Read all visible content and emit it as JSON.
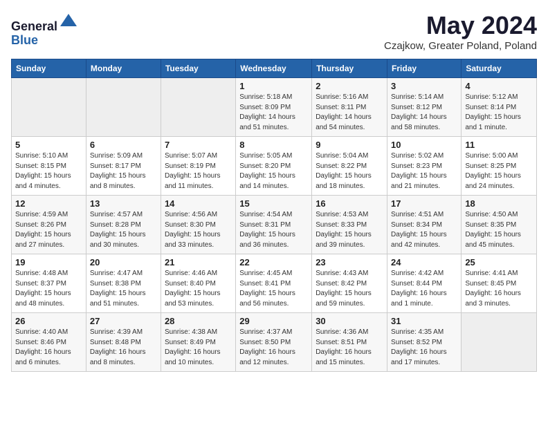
{
  "header": {
    "logo_line1": "General",
    "logo_line2": "Blue",
    "month": "May 2024",
    "location": "Czajkow, Greater Poland, Poland"
  },
  "weekdays": [
    "Sunday",
    "Monday",
    "Tuesday",
    "Wednesday",
    "Thursday",
    "Friday",
    "Saturday"
  ],
  "weeks": [
    [
      {
        "day": "",
        "info": ""
      },
      {
        "day": "",
        "info": ""
      },
      {
        "day": "",
        "info": ""
      },
      {
        "day": "1",
        "info": "Sunrise: 5:18 AM\nSunset: 8:09 PM\nDaylight: 14 hours\nand 51 minutes."
      },
      {
        "day": "2",
        "info": "Sunrise: 5:16 AM\nSunset: 8:11 PM\nDaylight: 14 hours\nand 54 minutes."
      },
      {
        "day": "3",
        "info": "Sunrise: 5:14 AM\nSunset: 8:12 PM\nDaylight: 14 hours\nand 58 minutes."
      },
      {
        "day": "4",
        "info": "Sunrise: 5:12 AM\nSunset: 8:14 PM\nDaylight: 15 hours\nand 1 minute."
      }
    ],
    [
      {
        "day": "5",
        "info": "Sunrise: 5:10 AM\nSunset: 8:15 PM\nDaylight: 15 hours\nand 4 minutes."
      },
      {
        "day": "6",
        "info": "Sunrise: 5:09 AM\nSunset: 8:17 PM\nDaylight: 15 hours\nand 8 minutes."
      },
      {
        "day": "7",
        "info": "Sunrise: 5:07 AM\nSunset: 8:19 PM\nDaylight: 15 hours\nand 11 minutes."
      },
      {
        "day": "8",
        "info": "Sunrise: 5:05 AM\nSunset: 8:20 PM\nDaylight: 15 hours\nand 14 minutes."
      },
      {
        "day": "9",
        "info": "Sunrise: 5:04 AM\nSunset: 8:22 PM\nDaylight: 15 hours\nand 18 minutes."
      },
      {
        "day": "10",
        "info": "Sunrise: 5:02 AM\nSunset: 8:23 PM\nDaylight: 15 hours\nand 21 minutes."
      },
      {
        "day": "11",
        "info": "Sunrise: 5:00 AM\nSunset: 8:25 PM\nDaylight: 15 hours\nand 24 minutes."
      }
    ],
    [
      {
        "day": "12",
        "info": "Sunrise: 4:59 AM\nSunset: 8:26 PM\nDaylight: 15 hours\nand 27 minutes."
      },
      {
        "day": "13",
        "info": "Sunrise: 4:57 AM\nSunset: 8:28 PM\nDaylight: 15 hours\nand 30 minutes."
      },
      {
        "day": "14",
        "info": "Sunrise: 4:56 AM\nSunset: 8:30 PM\nDaylight: 15 hours\nand 33 minutes."
      },
      {
        "day": "15",
        "info": "Sunrise: 4:54 AM\nSunset: 8:31 PM\nDaylight: 15 hours\nand 36 minutes."
      },
      {
        "day": "16",
        "info": "Sunrise: 4:53 AM\nSunset: 8:33 PM\nDaylight: 15 hours\nand 39 minutes."
      },
      {
        "day": "17",
        "info": "Sunrise: 4:51 AM\nSunset: 8:34 PM\nDaylight: 15 hours\nand 42 minutes."
      },
      {
        "day": "18",
        "info": "Sunrise: 4:50 AM\nSunset: 8:35 PM\nDaylight: 15 hours\nand 45 minutes."
      }
    ],
    [
      {
        "day": "19",
        "info": "Sunrise: 4:48 AM\nSunset: 8:37 PM\nDaylight: 15 hours\nand 48 minutes."
      },
      {
        "day": "20",
        "info": "Sunrise: 4:47 AM\nSunset: 8:38 PM\nDaylight: 15 hours\nand 51 minutes."
      },
      {
        "day": "21",
        "info": "Sunrise: 4:46 AM\nSunset: 8:40 PM\nDaylight: 15 hours\nand 53 minutes."
      },
      {
        "day": "22",
        "info": "Sunrise: 4:45 AM\nSunset: 8:41 PM\nDaylight: 15 hours\nand 56 minutes."
      },
      {
        "day": "23",
        "info": "Sunrise: 4:43 AM\nSunset: 8:42 PM\nDaylight: 15 hours\nand 59 minutes."
      },
      {
        "day": "24",
        "info": "Sunrise: 4:42 AM\nSunset: 8:44 PM\nDaylight: 16 hours\nand 1 minute."
      },
      {
        "day": "25",
        "info": "Sunrise: 4:41 AM\nSunset: 8:45 PM\nDaylight: 16 hours\nand 3 minutes."
      }
    ],
    [
      {
        "day": "26",
        "info": "Sunrise: 4:40 AM\nSunset: 8:46 PM\nDaylight: 16 hours\nand 6 minutes."
      },
      {
        "day": "27",
        "info": "Sunrise: 4:39 AM\nSunset: 8:48 PM\nDaylight: 16 hours\nand 8 minutes."
      },
      {
        "day": "28",
        "info": "Sunrise: 4:38 AM\nSunset: 8:49 PM\nDaylight: 16 hours\nand 10 minutes."
      },
      {
        "day": "29",
        "info": "Sunrise: 4:37 AM\nSunset: 8:50 PM\nDaylight: 16 hours\nand 12 minutes."
      },
      {
        "day": "30",
        "info": "Sunrise: 4:36 AM\nSunset: 8:51 PM\nDaylight: 16 hours\nand 15 minutes."
      },
      {
        "day": "31",
        "info": "Sunrise: 4:35 AM\nSunset: 8:52 PM\nDaylight: 16 hours\nand 17 minutes."
      },
      {
        "day": "",
        "info": ""
      }
    ]
  ]
}
